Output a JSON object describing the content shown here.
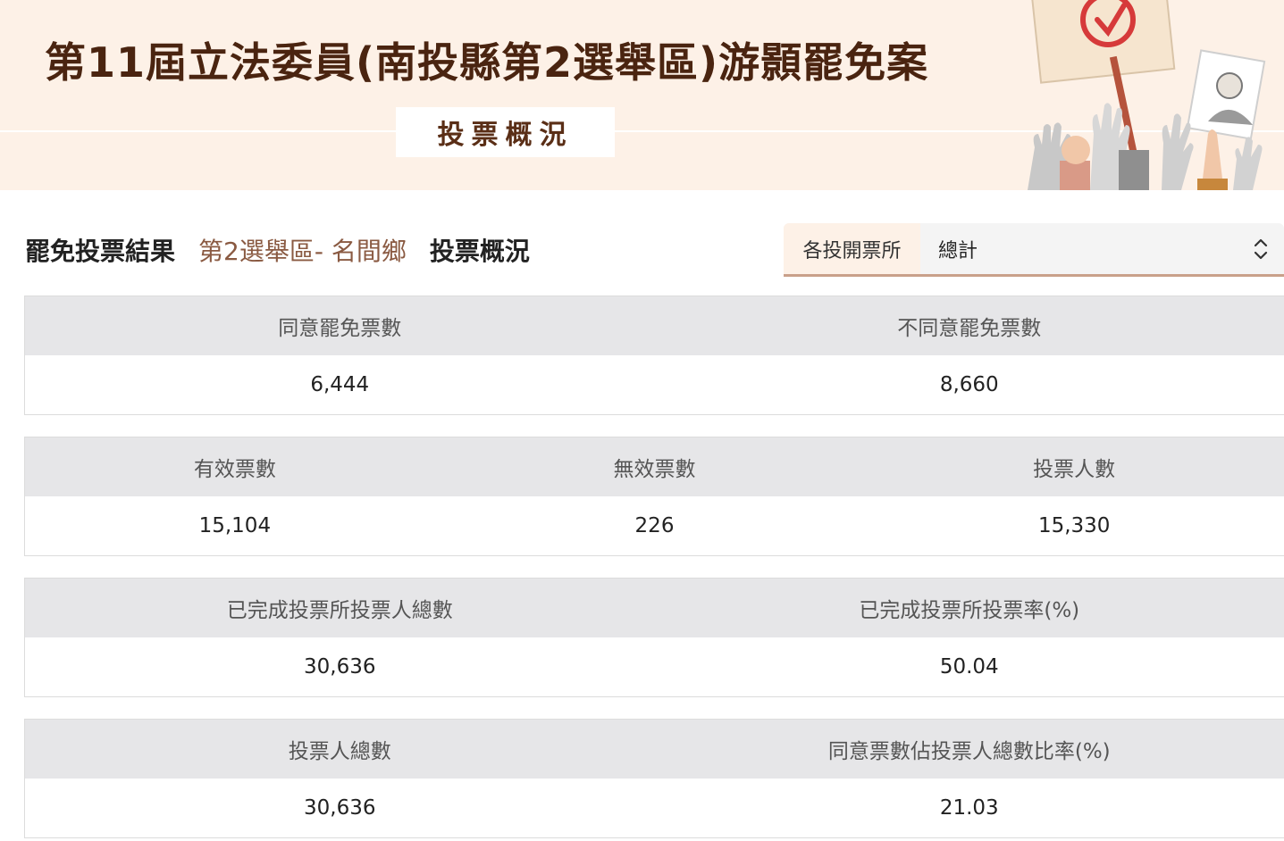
{
  "banner": {
    "title": "第11屆立法委員(南投縣第2選舉區)游顥罷免案",
    "subtitle": "投票概況",
    "art_icon": "protest-hands-illustration"
  },
  "result_header": {
    "part1": "罷免投票結果",
    "part2": "第2選舉區- 名間鄉",
    "part3": "投票概況"
  },
  "station_select": {
    "label": "各投開票所",
    "value": "總計"
  },
  "colors": {
    "banner_bg": "#fdf1e7",
    "title_brown": "#4a2410",
    "district_brown": "#8a5a42",
    "header_gray": "#e6e6e8"
  },
  "tables": [
    {
      "headers": [
        "同意罷免票數",
        "不同意罷免票數"
      ],
      "values": [
        "6,444",
        "8,660"
      ]
    },
    {
      "headers": [
        "有效票數",
        "無效票數",
        "投票人數"
      ],
      "values": [
        "15,104",
        "226",
        "15,330"
      ]
    },
    {
      "headers": [
        "已完成投票所投票人總數",
        "已完成投票所投票率(%)"
      ],
      "values": [
        "30,636",
        "50.04"
      ]
    },
    {
      "headers": [
        "投票人總數",
        "同意票數佔投票人總數比率(%)"
      ],
      "values": [
        "30,636",
        "21.03"
      ]
    }
  ]
}
